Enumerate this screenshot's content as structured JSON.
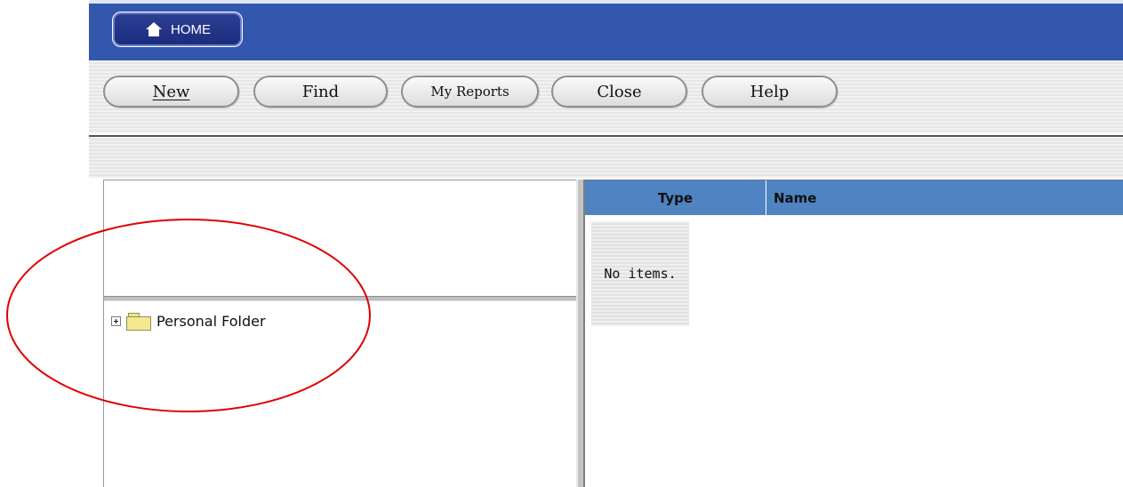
{
  "topbar": {
    "home_label": "HOME",
    "colors": {
      "bar": "#3357ad",
      "home_bg": "#1b2c7c"
    }
  },
  "toolbar": {
    "buttons": [
      {
        "label": "New"
      },
      {
        "label": "Find"
      },
      {
        "label": "My Reports"
      },
      {
        "label": "Close"
      },
      {
        "label": "Help"
      }
    ]
  },
  "tree": {
    "items": [
      {
        "label": "Personal Folder",
        "icon": "folder-icon",
        "expander": "plus-icon"
      }
    ]
  },
  "list": {
    "columns": [
      "Type",
      "Name"
    ],
    "empty_text": "No items."
  },
  "annotation": {
    "shape": "ellipse",
    "color": "#e00000"
  }
}
